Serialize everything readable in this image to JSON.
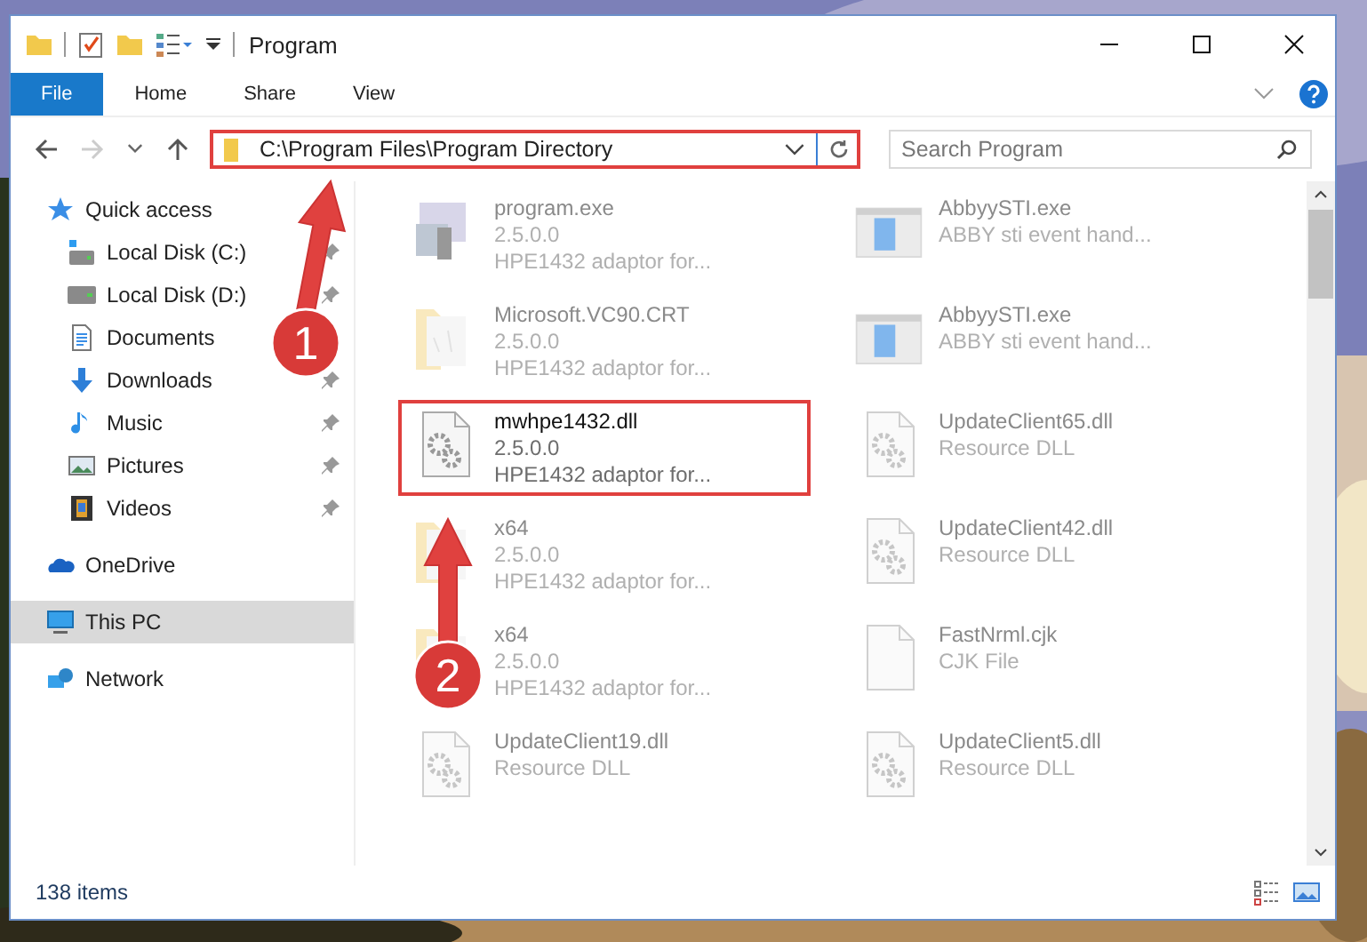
{
  "window": {
    "title": "Program"
  },
  "ribbon_tabs": [
    {
      "label": "File",
      "selected": true
    },
    {
      "label": "Home",
      "selected": false
    },
    {
      "label": "Share",
      "selected": false
    },
    {
      "label": "View",
      "selected": false
    }
  ],
  "navigation": {
    "back_disabled": false,
    "forward_disabled": true
  },
  "address_bar": {
    "value": "C:\\Program Files\\Program Directory",
    "highlighted": true
  },
  "search": {
    "placeholder": "Search Program"
  },
  "sidebar": {
    "items": [
      {
        "label": "Quick access",
        "kind": "star",
        "selected": false,
        "children": [
          {
            "label": "Local Disk (C:)",
            "kind": "drive-c",
            "pinned": true,
            "selected": false
          },
          {
            "label": "Local Disk (D:)",
            "kind": "drive",
            "pinned": true,
            "selected": false
          },
          {
            "label": "Documents",
            "kind": "document",
            "selected": false
          },
          {
            "label": "Downloads",
            "kind": "download",
            "pinned": true,
            "selected": false
          },
          {
            "label": "Music",
            "kind": "music",
            "pinned": true,
            "selected": false
          },
          {
            "label": "Pictures",
            "kind": "pictures",
            "pinned": true,
            "selected": false
          },
          {
            "label": "Videos",
            "kind": "videos",
            "pinned": true,
            "selected": false
          }
        ]
      },
      {
        "label": "OneDrive",
        "kind": "cloud",
        "selected": false
      },
      {
        "label": "This PC",
        "kind": "computer",
        "selected": true
      },
      {
        "label": "Network",
        "kind": "network",
        "selected": false
      }
    ]
  },
  "files": [
    {
      "name": "program.exe",
      "lines": [
        "2.5.0.0",
        "HPE1432 adaptor for..."
      ],
      "kind": "exe",
      "blurred": true,
      "highlighted": false
    },
    {
      "name": "AbbyySTI.exe",
      "lines": [
        "ABBY sti event hand..."
      ],
      "kind": "app",
      "blurred": true,
      "highlighted": false
    },
    {
      "name": "Microsoft.VC90.CRT",
      "lines": [
        "2.5.0.0",
        "HPE1432 adaptor for..."
      ],
      "kind": "folder",
      "blurred": true,
      "highlighted": false
    },
    {
      "name": "AbbyySTI.exe",
      "lines": [
        "ABBY sti event hand..."
      ],
      "kind": "app",
      "blurred": true,
      "highlighted": false
    },
    {
      "name": "mwhpe1432.dll",
      "lines": [
        "2.5.0.0",
        "HPE1432 adaptor for..."
      ],
      "kind": "dll",
      "blurred": false,
      "highlighted": true
    },
    {
      "name": "UpdateClient65.dll",
      "lines": [
        "Resource DLL"
      ],
      "kind": "dll",
      "blurred": true,
      "highlighted": false
    },
    {
      "name": "x64",
      "lines": [
        "2.5.0.0",
        "HPE1432 adaptor for..."
      ],
      "kind": "folder",
      "blurred": true,
      "highlighted": false
    },
    {
      "name": "UpdateClient42.dll",
      "lines": [
        "Resource DLL"
      ],
      "kind": "dll",
      "blurred": true,
      "highlighted": false
    },
    {
      "name": "x64",
      "lines": [
        "2.5.0.0",
        "HPE1432 adaptor for..."
      ],
      "kind": "folder",
      "blurred": true,
      "highlighted": false
    },
    {
      "name": "FastNrml.cjk",
      "lines": [
        "CJK File"
      ],
      "kind": "file",
      "blurred": true,
      "highlighted": false
    },
    {
      "name": "UpdateClient19.dll",
      "lines": [
        "Resource DLL"
      ],
      "kind": "dll",
      "blurred": true,
      "highlighted": false
    },
    {
      "name": "UpdateClient5.dll",
      "lines": [
        "Resource DLL"
      ],
      "kind": "dll",
      "blurred": true,
      "highlighted": false
    }
  ],
  "status_bar": {
    "item_count": "138 items"
  },
  "annotations": [
    {
      "number": "1"
    },
    {
      "number": "2"
    }
  ]
}
